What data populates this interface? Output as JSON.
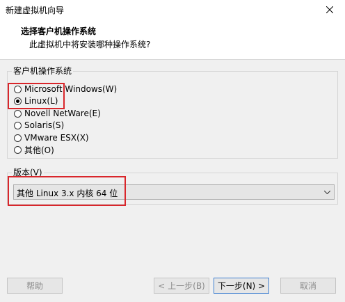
{
  "window": {
    "title": "新建虚拟机向导"
  },
  "header": {
    "title": "选择客户机操作系统",
    "subtitle": "此虚拟机中将安装哪种操作系统?"
  },
  "os_group": {
    "label": "客户机操作系统",
    "options": [
      {
        "label": "Microsoft Windows(W)",
        "checked": false
      },
      {
        "label": "Linux(L)",
        "checked": true
      },
      {
        "label": "Novell NetWare(E)",
        "checked": false
      },
      {
        "label": "Solaris(S)",
        "checked": false
      },
      {
        "label": "VMware ESX(X)",
        "checked": false
      },
      {
        "label": "其他(O)",
        "checked": false
      }
    ]
  },
  "version_group": {
    "label": "版本(V)",
    "selected": "其他 Linux 3.x 内核 64 位"
  },
  "buttons": {
    "help": "帮助",
    "back": "< 上一步(B)",
    "next": "下一步(N) >",
    "cancel": "取消"
  },
  "colors": {
    "highlight": "#d9262b",
    "focus_border": "#3f7fd0"
  }
}
